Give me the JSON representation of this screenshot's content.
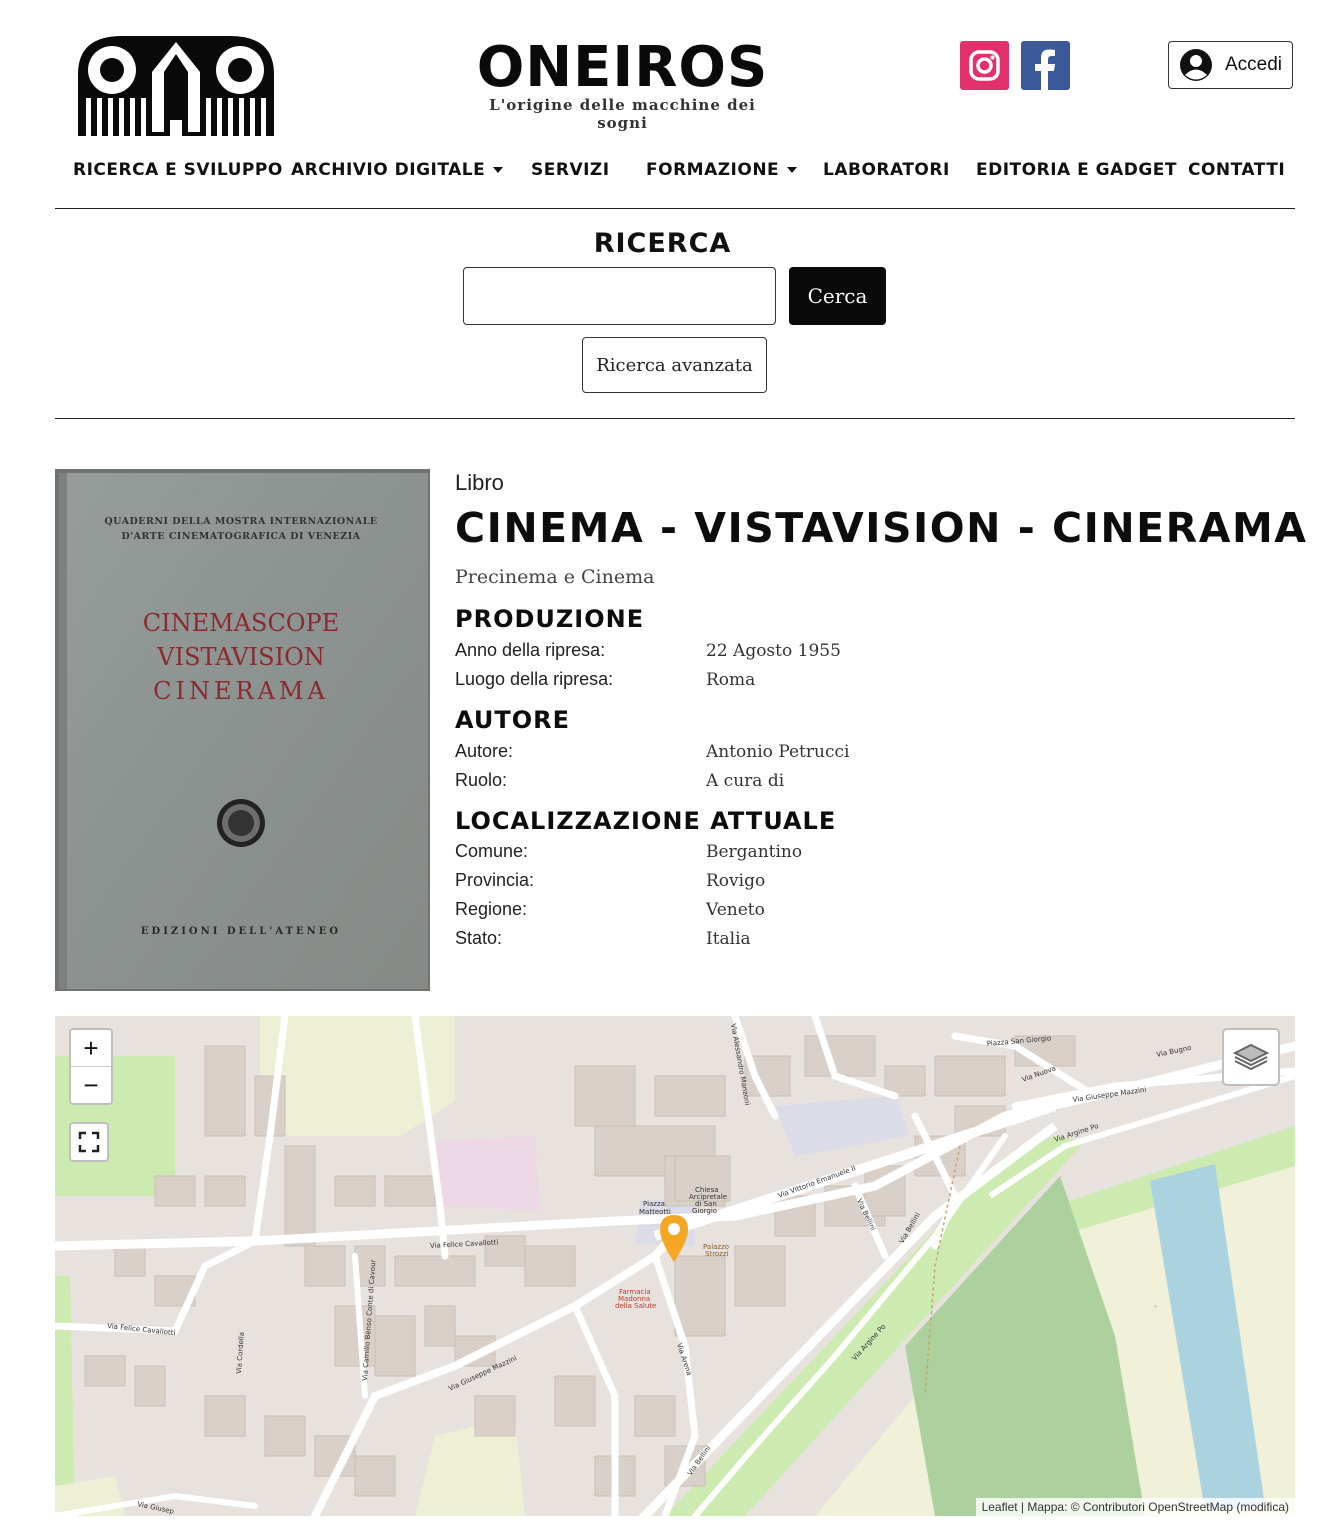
{
  "header": {
    "site_name": "ONEIROS",
    "tagline": "L'origine delle macchine dei sogni",
    "login_label": "Accedi"
  },
  "nav": {
    "items": [
      {
        "label": "RICERCA E SVILUPPO"
      },
      {
        "label": "ARCHIVIO DIGITALE"
      },
      {
        "label": "SERVIZI"
      },
      {
        "label": "FORMAZIONE"
      },
      {
        "label": "LABORATORI"
      },
      {
        "label": "EDITORIA E GADGET"
      },
      {
        "label": "CONTATTI"
      }
    ]
  },
  "search": {
    "title": "RICERCA",
    "value": "",
    "button": "Cerca",
    "advanced": "Ricerca avanzata"
  },
  "cover": {
    "series_line1": "QUADERNI DELLA MOSTRA INTERNAZIONALE",
    "series_line2": "D'ARTE CINEMATOGRAFICA DI VENEZIA",
    "title_line1": "CINEMASCOPE",
    "title_line2": "VISTAVISION",
    "title_line3": "CINERAMA",
    "publisher": "EDIZIONI DELL'ATENEO"
  },
  "record": {
    "type": "Libro",
    "title": "CINEMA - VISTAVISION - CINERAMA",
    "category": "Precinema e Cinema",
    "produzione": {
      "heading": "PRODUZIONE",
      "anno_label": "Anno della ripresa:",
      "anno_value": "22 Agosto 1955",
      "luogo_label": "Luogo della ripresa:",
      "luogo_value": "Roma"
    },
    "autore": {
      "heading": "AUTORE",
      "autore_label": "Autore:",
      "autore_value": "Antonio Petrucci",
      "ruolo_label": "Ruolo:",
      "ruolo_value": "A cura di"
    },
    "localizzazione": {
      "heading": "LOCALIZZAZIONE ATTUALE",
      "comune_label": "Comune:",
      "comune_value": "Bergantino",
      "provincia_label": "Provincia:",
      "provincia_value": "Rovigo",
      "regione_label": "Regione:",
      "regione_value": "Veneto",
      "stato_label": "Stato:",
      "stato_value": "Italia"
    }
  },
  "map": {
    "zoom_in": "+",
    "zoom_out": "−",
    "attribution": "Leaflet | Mappa: © Contributori OpenStreetMap (modifica)",
    "labels": {
      "via_felice_cavallotti_1": "Via Felice Cavallotti",
      "via_felice_cavallotti_2": "Via Felice Cavallotti",
      "via_vittorio_emanuele": "Via Vittorio Emanuele II",
      "via_giuseppe_mazzini_1": "Via Giuseppe Mazzini",
      "via_giuseppe_mazzini_2": "Via Giuseppe Mazzini",
      "via_argine_po_1": "Via Argine Po",
      "via_argine_po_2": "Via Argine Po",
      "via_nuova": "Via Nuova",
      "via_bugno": "Via Bugno",
      "piazza_san_giorgio": "Piazza San Giorgio",
      "via_bellini_1": "Via Bellini",
      "via_bellini_2": "Via Bellini",
      "via_bellini_3": "Via Bellini",
      "via_arena": "Via Arena",
      "via_cordella": "Via Cordella",
      "via_camillo": "Via Camillo Benso Conte di Cavour",
      "via_manzoni": "Via Alessandro Manzoni",
      "via_giusep": "Via Giusep",
      "piazza_matteotti_1": "Piazza",
      "piazza_matteotti_2": "Matteotti",
      "chiesa_1": "Chiesa",
      "chiesa_2": "Arcipretale",
      "chiesa_3": "di San",
      "chiesa_4": "Giorgio",
      "palazzo_1": "Palazzo",
      "palazzo_2": "Strozzi",
      "farmacia_1": "Farmacia",
      "farmacia_2": "Madonna",
      "farmacia_3": "della Salute"
    },
    "colors": {
      "water": "#aad3df",
      "grass": "#cdebb0",
      "forest": "#add19e",
      "land": "#e7e2de",
      "building": "#d9d0c9",
      "marker": "#f5a623"
    }
  }
}
